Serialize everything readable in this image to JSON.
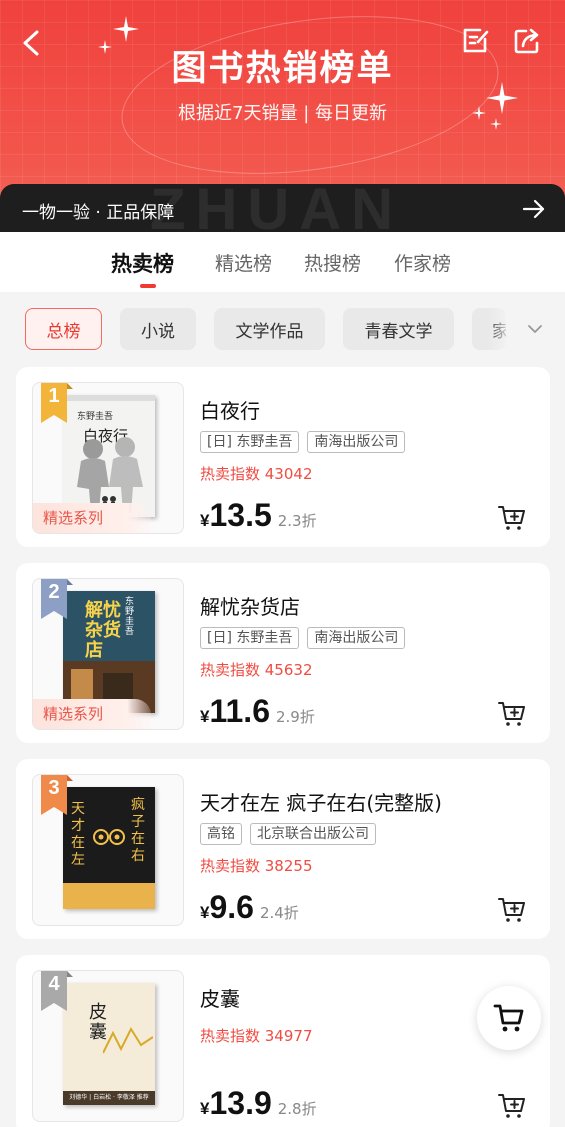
{
  "header": {
    "title": "图书热销榜单",
    "subtitle": "根据近7天销量 | 每日更新"
  },
  "guarantee": {
    "text": "一物一验 · 正品保障",
    "background_word": "ZHUAN"
  },
  "tabs": [
    {
      "label": "热卖榜",
      "active": true
    },
    {
      "label": "精选榜"
    },
    {
      "label": "热搜榜"
    },
    {
      "label": "作家榜"
    }
  ],
  "categories": [
    {
      "label": "总榜",
      "active": true
    },
    {
      "label": "小说"
    },
    {
      "label": "文学作品"
    },
    {
      "label": "青春文学"
    },
    {
      "label": "家"
    }
  ],
  "books": [
    {
      "rank": "1",
      "title": "白夜行",
      "tags": [
        "[日] 东野圭吾",
        "南海出版公司"
      ],
      "hot_index": "热卖指数 43042",
      "price_symbol": "¥",
      "price": "13.5",
      "discount": "2.3折",
      "series_tag": "精选系列",
      "cover": {
        "author": "东野圭吾",
        "title": "白夜行"
      }
    },
    {
      "rank": "2",
      "title": "解忧杂货店",
      "tags": [
        "[日] 东野圭吾",
        "南海出版公司"
      ],
      "hot_index": "热卖指数 45632",
      "price_symbol": "¥",
      "price": "11.6",
      "discount": "2.9折",
      "series_tag": "精选系列",
      "cover": {
        "author": "东野圭吾",
        "title": "解忧杂货店"
      }
    },
    {
      "rank": "3",
      "title": "天才在左 疯子在右(完整版)",
      "tags": [
        "高铭",
        "北京联合出版公司"
      ],
      "hot_index": "热卖指数 38255",
      "price_symbol": "¥",
      "price": "9.6",
      "discount": "2.4折",
      "cover": {
        "left": "天才在左",
        "right": "疯子在右"
      }
    },
    {
      "rank": "4",
      "title": "皮囊",
      "tags": [],
      "hot_index": "热卖指数 34977",
      "price_symbol": "¥",
      "price": "13.9",
      "discount": "2.8折",
      "cover": {
        "title": "皮囊",
        "footer": "刘德华 | 白岩松 · 李敬泽 推荐"
      }
    }
  ],
  "colors": {
    "brand_red": "#f0413d",
    "hot_text": "#ef4d43",
    "rank_gold": "#f3b43a",
    "rank_blue": "#8e9fc6",
    "rank_orange": "#f08a4b",
    "rank_gray": "#a9a9a9"
  },
  "icons": [
    "back-arrow-icon",
    "edit-icon",
    "share-icon",
    "right-arrow-icon",
    "chevron-down-icon",
    "add-to-cart-icon",
    "shopping-cart-icon",
    "sparkle-icon"
  ]
}
